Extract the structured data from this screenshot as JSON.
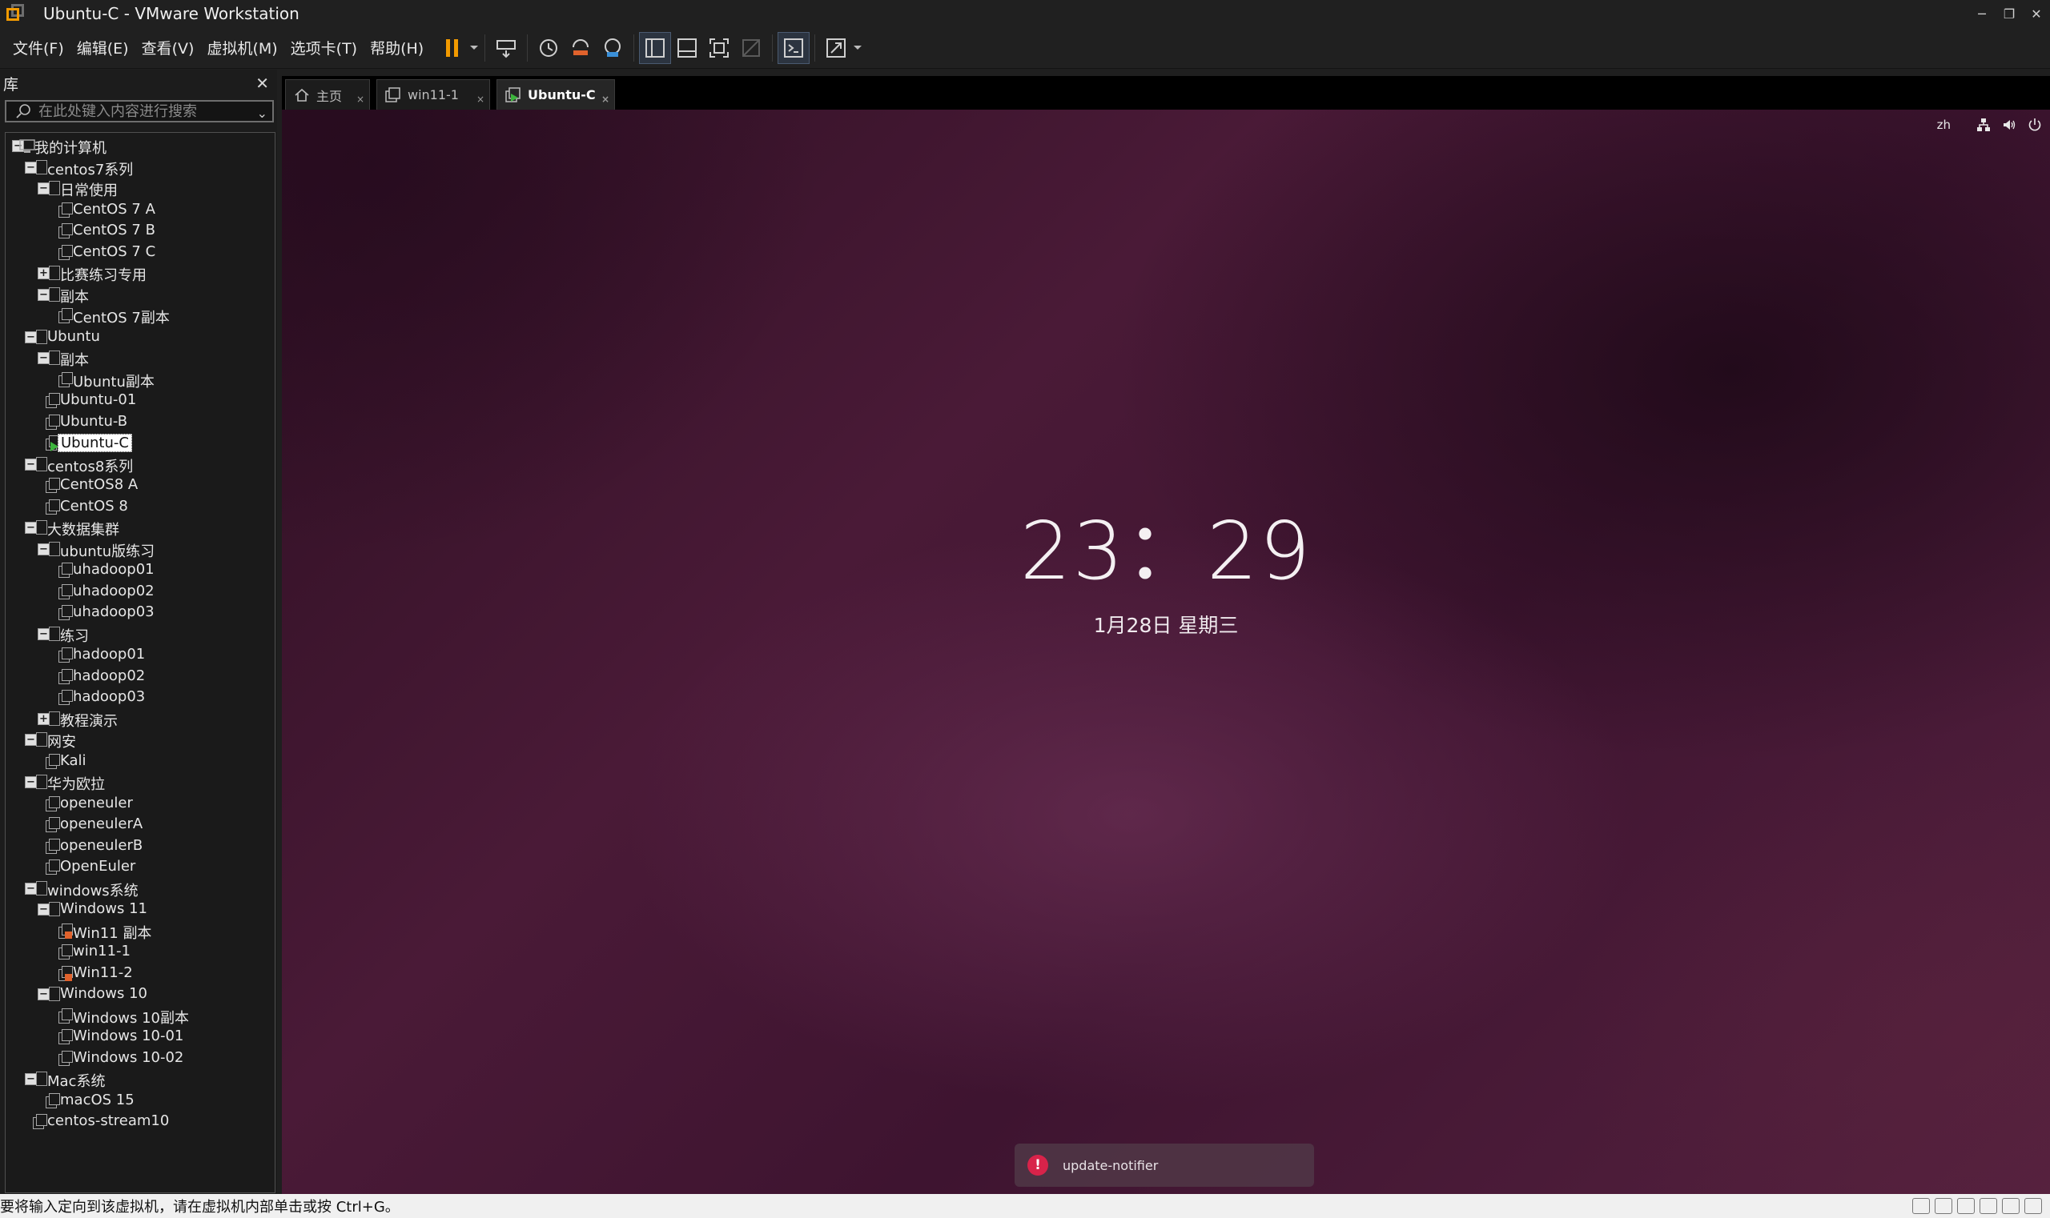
{
  "window": {
    "title": "Ubuntu-C - VMware Workstation",
    "controls": [
      "─",
      "❐",
      "✕"
    ]
  },
  "menu": [
    "文件(F)",
    "编辑(E)",
    "查看(V)",
    "虚拟机(M)",
    "选项卡(T)",
    "帮助(H)"
  ],
  "library": {
    "title": "库",
    "close": "✕",
    "search_placeholder": "在此处键入内容进行搜索",
    "tree": [
      {
        "label": "我的计算机",
        "level": 0,
        "kind": "pc",
        "exp": "minus"
      },
      {
        "label": "centos7系列",
        "level": 1,
        "kind": "folder",
        "exp": "minus"
      },
      {
        "label": "日常使用",
        "level": 2,
        "kind": "folder",
        "exp": "minus"
      },
      {
        "label": "CentOS 7 A",
        "level": 3,
        "kind": "vm"
      },
      {
        "label": "CentOS 7  B",
        "level": 3,
        "kind": "vm"
      },
      {
        "label": "CentOS 7 C",
        "level": 3,
        "kind": "vm"
      },
      {
        "label": "比赛练习专用",
        "level": 2,
        "kind": "folder",
        "exp": "plus"
      },
      {
        "label": "副本",
        "level": 2,
        "kind": "folder",
        "exp": "minus"
      },
      {
        "label": "CentOS 7副本",
        "level": 3,
        "kind": "vm"
      },
      {
        "label": "Ubuntu",
        "level": 1,
        "kind": "folder",
        "exp": "minus"
      },
      {
        "label": "副本",
        "level": 2,
        "kind": "folder",
        "exp": "minus"
      },
      {
        "label": "Ubuntu副本",
        "level": 3,
        "kind": "vm"
      },
      {
        "label": "Ubuntu-01",
        "level": 2,
        "kind": "vm"
      },
      {
        "label": "Ubuntu-B",
        "level": 2,
        "kind": "vm"
      },
      {
        "label": "Ubuntu-C",
        "level": 2,
        "kind": "vm-running",
        "selected": true
      },
      {
        "label": "centos8系列",
        "level": 1,
        "kind": "folder",
        "exp": "minus"
      },
      {
        "label": "CentOS8 A",
        "level": 2,
        "kind": "vm"
      },
      {
        "label": "CentOS 8",
        "level": 2,
        "kind": "vm"
      },
      {
        "label": "大数据集群",
        "level": 1,
        "kind": "folder",
        "exp": "minus"
      },
      {
        "label": "ubuntu版练习",
        "level": 2,
        "kind": "folder",
        "exp": "minus"
      },
      {
        "label": "uhadoop01",
        "level": 3,
        "kind": "vm"
      },
      {
        "label": "uhadoop02",
        "level": 3,
        "kind": "vm"
      },
      {
        "label": "uhadoop03",
        "level": 3,
        "kind": "vm"
      },
      {
        "label": "练习",
        "level": 2,
        "kind": "folder",
        "exp": "minus"
      },
      {
        "label": "hadoop01",
        "level": 3,
        "kind": "vm"
      },
      {
        "label": "hadoop02",
        "level": 3,
        "kind": "vm"
      },
      {
        "label": "hadoop03",
        "level": 3,
        "kind": "vm"
      },
      {
        "label": "教程演示",
        "level": 2,
        "kind": "folder",
        "exp": "plus"
      },
      {
        "label": "网安",
        "level": 1,
        "kind": "folder",
        "exp": "minus"
      },
      {
        "label": "Kali",
        "level": 2,
        "kind": "vm"
      },
      {
        "label": "华为欧拉",
        "level": 1,
        "kind": "folder",
        "exp": "minus"
      },
      {
        "label": "openeuler",
        "level": 2,
        "kind": "vm"
      },
      {
        "label": "openeulerA",
        "level": 2,
        "kind": "vm"
      },
      {
        "label": "openeulerB",
        "level": 2,
        "kind": "vm"
      },
      {
        "label": "OpenEuler",
        "level": 2,
        "kind": "vm"
      },
      {
        "label": "windows系统",
        "level": 1,
        "kind": "folder",
        "exp": "minus"
      },
      {
        "label": "Windows 11",
        "level": 2,
        "kind": "folder",
        "exp": "minus"
      },
      {
        "label": "Win11 副本",
        "level": 3,
        "kind": "vm-locked"
      },
      {
        "label": "win11-1",
        "level": 3,
        "kind": "vm"
      },
      {
        "label": "Win11-2",
        "level": 3,
        "kind": "vm-locked"
      },
      {
        "label": "Windows 10",
        "level": 2,
        "kind": "folder",
        "exp": "minus"
      },
      {
        "label": "Windows 10副本",
        "level": 3,
        "kind": "vm"
      },
      {
        "label": "Windows 10-01",
        "level": 3,
        "kind": "vm"
      },
      {
        "label": "Windows 10-02",
        "level": 3,
        "kind": "vm"
      },
      {
        "label": "Mac系统",
        "level": 1,
        "kind": "folder",
        "exp": "minus"
      },
      {
        "label": "macOS 15",
        "level": 2,
        "kind": "vm"
      },
      {
        "label": "centos-stream10",
        "level": 1,
        "kind": "vm"
      }
    ]
  },
  "tabs": [
    {
      "label": "主页",
      "icon": "home-icon"
    },
    {
      "label": "win11-1",
      "icon": "vm-icon"
    },
    {
      "label": "Ubuntu-C",
      "icon": "vm-running-icon",
      "active": true
    }
  ],
  "vm": {
    "topbar_lang": "zh",
    "clock": "23：29",
    "date": "1月28日 星期三",
    "notification": "update-notifier",
    "notification_icon": "!"
  },
  "status": {
    "text": "要将输入定向到该虚拟机，请在虚拟机内部单击或按 Ctrl+G。"
  },
  "colors": {
    "accent_orange": "#f29a00",
    "running_green": "#3db53d",
    "notif_red": "#d8234a"
  }
}
